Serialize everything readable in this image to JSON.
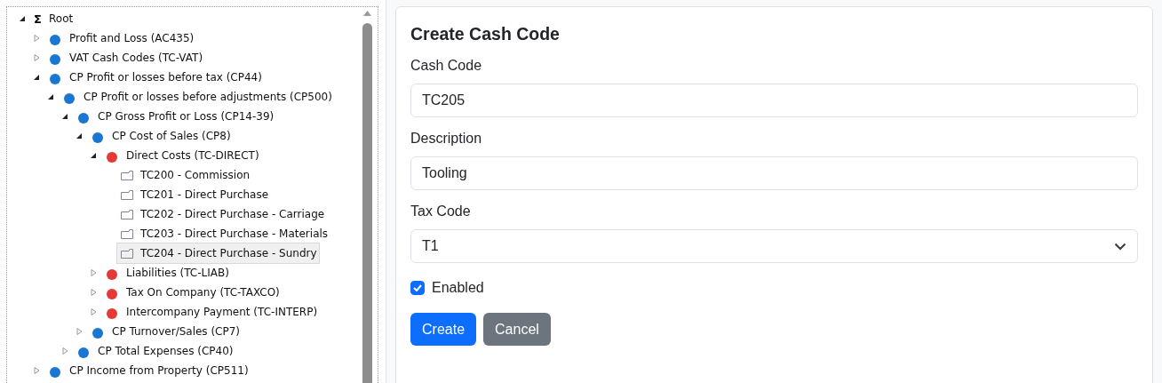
{
  "tree": {
    "label": "Root",
    "glyph": "Σ",
    "kind": "root",
    "expanded": true,
    "selected": false,
    "children": [
      {
        "label": "Profit and Loss (AC435)",
        "kind": "category",
        "color": "#1976d2",
        "expanded": false,
        "selected": false
      },
      {
        "label": "VAT Cash Codes (TC-VAT)",
        "kind": "category",
        "color": "#1976d2",
        "expanded": false,
        "selected": false
      },
      {
        "label": "CP Profit or losses before tax (CP44)",
        "kind": "category",
        "color": "#1976d2",
        "expanded": true,
        "selected": false,
        "children": [
          {
            "label": "CP Profit or losses before adjustments (CP500)",
            "kind": "category",
            "color": "#1976d2",
            "expanded": true,
            "selected": false,
            "children": [
              {
                "label": "CP Gross Profit or Loss (CP14-39)",
                "kind": "category",
                "color": "#1976d2",
                "expanded": true,
                "selected": false,
                "children": [
                  {
                    "label": "CP Cost of Sales (CP8)",
                    "kind": "category",
                    "color": "#1976d2",
                    "expanded": true,
                    "selected": false,
                    "children": [
                      {
                        "label": "Direct Costs (TC-DIRECT)",
                        "kind": "category",
                        "color": "#e53935",
                        "expanded": true,
                        "selected": false,
                        "children": [
                          {
                            "label": "TC200 - Commission",
                            "kind": "code",
                            "selected": false
                          },
                          {
                            "label": "TC201 - Direct Purchase",
                            "kind": "code",
                            "selected": false
                          },
                          {
                            "label": "TC202 - Direct Purchase - Carriage",
                            "kind": "code",
                            "selected": false
                          },
                          {
                            "label": "TC203 - Direct Purchase - Materials",
                            "kind": "code",
                            "selected": false
                          },
                          {
                            "label": "TC204 - Direct Purchase - Sundry",
                            "kind": "code",
                            "selected": true
                          }
                        ]
                      },
                      {
                        "label": "Liabilities (TC-LIAB)",
                        "kind": "category",
                        "color": "#e53935",
                        "expanded": false,
                        "selected": false
                      },
                      {
                        "label": "Tax On Company (TC-TAXCO)",
                        "kind": "category",
                        "color": "#e53935",
                        "expanded": false,
                        "selected": false
                      },
                      {
                        "label": "Intercompany Payment (TC-INTERP)",
                        "kind": "category",
                        "color": "#e53935",
                        "expanded": false,
                        "selected": false
                      }
                    ]
                  },
                  {
                    "label": "CP Turnover/Sales (CP7)",
                    "kind": "category",
                    "color": "#1976d2",
                    "expanded": false,
                    "selected": false
                  }
                ]
              },
              {
                "label": "CP Total Expenses (CP40)",
                "kind": "category",
                "color": "#1976d2",
                "expanded": false,
                "selected": false
              }
            ]
          }
        ]
      },
      {
        "label": "CP Income from Property (CP511)",
        "kind": "category",
        "color": "#1976d2",
        "expanded": false,
        "selected": false
      }
    ]
  },
  "form": {
    "title": "Create Cash Code",
    "fields": [
      {
        "label": "Cash Code",
        "kind": "text",
        "value": "TC205"
      },
      {
        "label": "Description",
        "kind": "text",
        "value": "Tooling"
      },
      {
        "label": "Tax Code",
        "kind": "select",
        "value": "T1"
      }
    ],
    "checkbox": {
      "label": "Enabled",
      "checked": true
    },
    "buttons": [
      {
        "label": "Create",
        "kind": "primary"
      },
      {
        "label": "Cancel",
        "kind": "secondary"
      }
    ]
  }
}
